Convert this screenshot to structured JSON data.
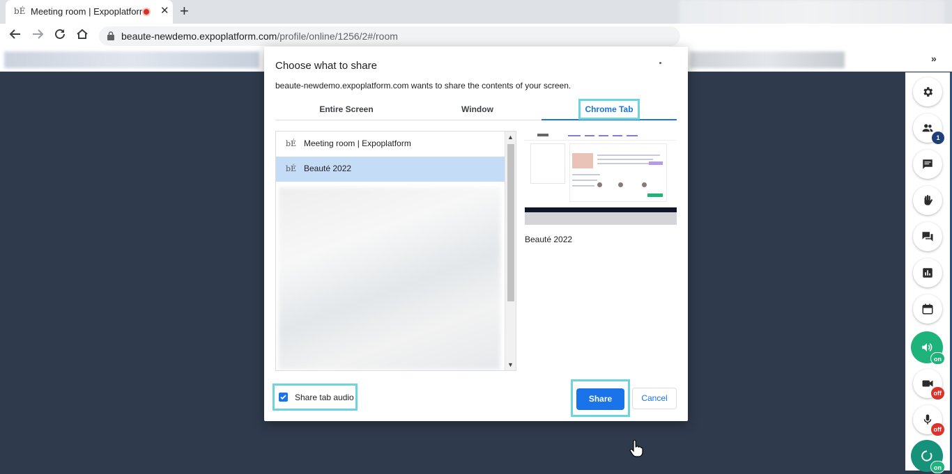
{
  "browser": {
    "tab": {
      "favicon": "bÉ",
      "title": "Meeting room | Expoplatform"
    },
    "url_host": "beaute-newdemo.expoplatform.com",
    "url_path": "/profile/online/1256/2#/room",
    "icons": [
      "back-icon",
      "forward-icon",
      "reload-icon",
      "home-icon",
      "lock-icon",
      "recording-dot-icon",
      "close-icon",
      "plus-icon",
      "chevron-double-right-icon"
    ]
  },
  "dialog": {
    "title": "Choose what to share",
    "subtitle": "beaute-newdemo.expoplatform.com wants to share the contents of your screen.",
    "tabs": [
      {
        "label": "Entire Screen",
        "active": false
      },
      {
        "label": "Window",
        "active": false
      },
      {
        "label": "Chrome Tab",
        "active": true
      }
    ],
    "items": [
      {
        "icon": "bÉ",
        "label": "Meeting room | Expoplatform",
        "selected": false
      },
      {
        "icon": "bÉ",
        "label": "Beauté 2022",
        "selected": true
      }
    ],
    "preview_label": "Beauté 2022",
    "share_audio_label": "Share tab audio",
    "share_audio_checked": true,
    "share_label": "Share",
    "cancel_label": "Cancel"
  },
  "sidebar": {
    "buttons": [
      {
        "icon": "gear-icon"
      },
      {
        "icon": "people-icon",
        "badge": "1"
      },
      {
        "icon": "chat-icon"
      },
      {
        "icon": "raise-hand-icon"
      },
      {
        "icon": "forum-icon"
      },
      {
        "icon": "poll-icon"
      },
      {
        "icon": "calendar-icon"
      },
      {
        "icon": "speaker-icon",
        "badge": "on"
      },
      {
        "icon": "camera-icon",
        "badge": "off"
      },
      {
        "icon": "microphone-icon",
        "badge": "off"
      },
      {
        "icon": "refresh-icon",
        "badge": "on"
      }
    ]
  },
  "colors": {
    "accent": "#1a73e8",
    "highlight": "#6ad5e0",
    "selected_row": "#c5dcf7",
    "page_bg": "#2f3a4c",
    "on_green": "#1eb37a",
    "off_red": "#d9342b"
  }
}
